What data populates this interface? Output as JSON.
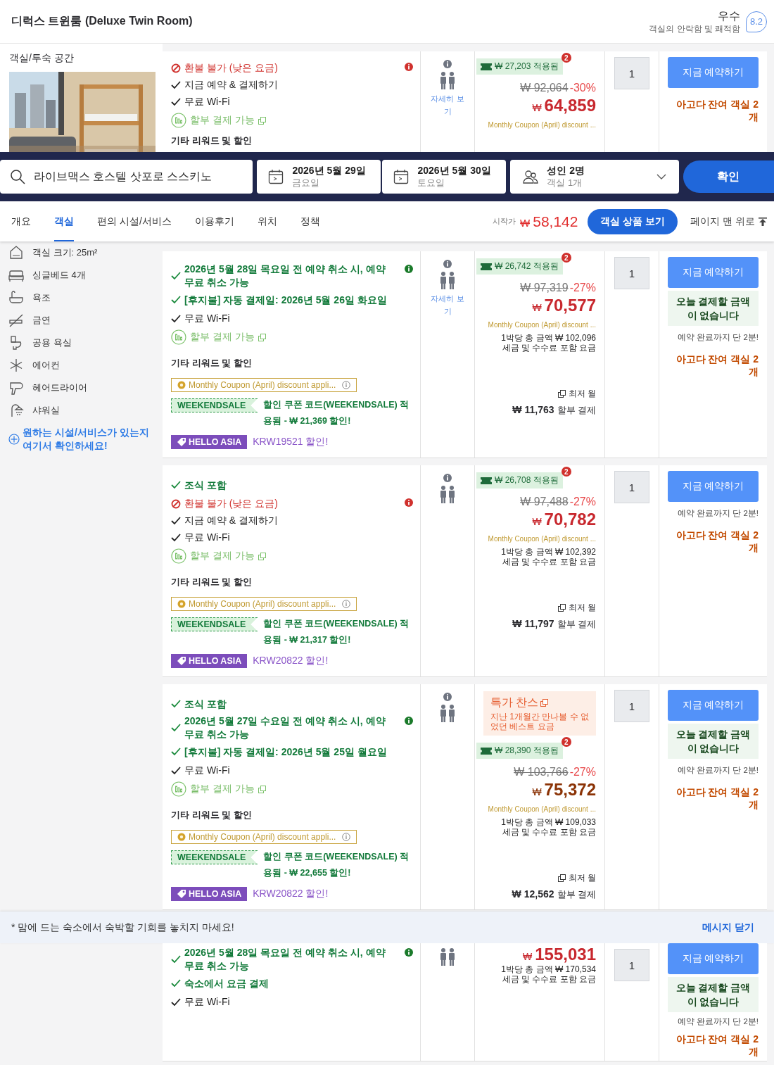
{
  "room": {
    "title": "디럭스 트윈룸 (Deluxe Twin Room)",
    "rating_label": "우수",
    "rating_sub": "객실의 안락함 및 쾌적함",
    "score": "8.2"
  },
  "room_info": {
    "heading": "객실/투숙 공간"
  },
  "top_offer": {
    "features": [
      {
        "kind": "refund",
        "text": "환불 불가 (낮은 요금)",
        "info": true
      },
      {
        "kind": "plain",
        "text": "지금 예약 & 결제하기",
        "info": false
      },
      {
        "kind": "plain",
        "text": "무료 Wi-Fi",
        "info": false
      },
      {
        "kind": "installment",
        "text": "할부 결제 가능",
        "info": false
      }
    ],
    "rewards": {
      "heading": "기타 리워드 및 할인"
    },
    "occupancy": {
      "info": true,
      "details_link": "자세히 보기"
    },
    "price": {
      "applied": "₩ 27,203 적용됨",
      "badge": "2",
      "original": "₩ 92,064",
      "discount": "-30%",
      "currency": "₩",
      "amount": "64,859",
      "coupon_note": "Monthly Coupon (April) discount ..."
    },
    "quantity": "1",
    "book": {
      "button": "지금 예약하기",
      "rooms_left": "아고다 잔여 객실 2개"
    }
  },
  "search": {
    "destination": "라이브맥스 호스텔 삿포로 스스키노",
    "checkin_date": "2026년 5월 29일",
    "checkin_day": "금요일",
    "checkout_date": "2026년 5월 30일",
    "checkout_day": "토요일",
    "guests": "성인 2명",
    "rooms": "객실 1개",
    "confirm": "확인"
  },
  "nav": {
    "tabs": [
      {
        "label": "개요",
        "selected": false
      },
      {
        "label": "객실",
        "selected": true
      },
      {
        "label": "편의 시설/서비스",
        "selected": false
      },
      {
        "label": "이용후기",
        "selected": false
      },
      {
        "label": "위치",
        "selected": false
      },
      {
        "label": "정책",
        "selected": false
      }
    ],
    "from_label": "시작가",
    "from_currency": "₩",
    "from_price": "58,142",
    "view_button": "객실 상품 보기",
    "top_link": "페이지 맨 위로"
  },
  "amenities": [
    {
      "kind": "size",
      "text": "객실 크기: 25m²"
    },
    {
      "kind": "bed",
      "text": "싱글베드 4개"
    },
    {
      "kind": "bath",
      "text": "욕조"
    },
    {
      "kind": "nosmoking",
      "text": "금연"
    },
    {
      "kind": "toilet",
      "text": "공용 욕실"
    },
    {
      "kind": "aircon",
      "text": "에어컨"
    },
    {
      "kind": "hairdryer",
      "text": "헤어드라이어"
    },
    {
      "kind": "shower",
      "text": "샤워실"
    }
  ],
  "amenity_link": "원하는 시설/서비스가 있는지 여기서 확인하세요!",
  "offers": [
    {
      "features": [
        {
          "kind": "included",
          "text": "2026년 5월 28일 목요일 전 예약 취소 시, 예약 무료 취소 가능",
          "info": true
        },
        {
          "kind": "included",
          "text": "[후지불] 자동 결제일: 2026년 5월 26일 화요일",
          "info": false
        },
        {
          "kind": "plain",
          "text": "무료 Wi-Fi",
          "info": false
        },
        {
          "kind": "installment",
          "text": "할부 결제 가능",
          "info": false
        }
      ],
      "rewards": {
        "heading": "기타 리워드 및 할인",
        "coupon": "Monthly Coupon (April) discount appli...",
        "code": "WEEKENDSALE",
        "code_text": "할인 쿠폰 코드(WEEKENDSALE) 적용됨 - ₩ 21,369 할인!",
        "promo": "HELLO ASIA",
        "promo_text": "KRW19521 할인!"
      },
      "occupancy": {
        "info": true,
        "details_link": "자세히 보기"
      },
      "price": {
        "applied": "₩ 26,742 적용됨",
        "badge": "2",
        "original": "₩ 97,319",
        "discount": "-27%",
        "currency": "₩",
        "amount": "70,577",
        "coupon_note": "Monthly Coupon (April) discount ...",
        "total": "1박당 총 금액 ₩ 102,096",
        "tax_note": "세금 및 수수료 포함 요금",
        "monthly_label": "최저 월",
        "monthly": "₩ 11,763",
        "monthly_suffix": "할부 결제"
      },
      "quantity": "1",
      "book": {
        "button": "지금 예약하기",
        "pay_later": "오늘 결제할 금액이 없습니다",
        "timer": "예약 완료까지 단 2분!",
        "rooms_left": "아고다 잔여 객실 2개"
      }
    },
    {
      "features": [
        {
          "kind": "included",
          "text": "조식 포함",
          "info": false
        },
        {
          "kind": "refund",
          "text": "환불 불가 (낮은 요금)",
          "info": true
        },
        {
          "kind": "plain",
          "text": "지금 예약 & 결제하기",
          "info": false
        },
        {
          "kind": "plain",
          "text": "무료 Wi-Fi",
          "info": false
        },
        {
          "kind": "installment",
          "text": "할부 결제 가능",
          "info": false
        }
      ],
      "rewards": {
        "heading": "기타 리워드 및 할인",
        "coupon": "Monthly Coupon (April) discount appli...",
        "code": "WEEKENDSALE",
        "code_text": "할인 쿠폰 코드(WEEKENDSALE) 적용됨 - ₩ 21,317 할인!",
        "promo": "HELLO ASIA",
        "promo_text": "KRW20822 할인!"
      },
      "occupancy": {
        "info": true
      },
      "price": {
        "applied": "₩ 26,708 적용됨",
        "badge": "2",
        "original": "₩ 97,488",
        "discount": "-27%",
        "currency": "₩",
        "amount": "70,782",
        "coupon_note": "Monthly Coupon (April) discount ...",
        "total": "1박당 총 금액 ₩ 102,392",
        "tax_note": "세금 및 수수료 포함 요금",
        "monthly_label": "최저 월",
        "monthly": "₩ 11,797",
        "monthly_suffix": "할부 결제"
      },
      "quantity": "1",
      "book": {
        "button": "지금 예약하기",
        "timer": "예약 완료까지 단 2분!",
        "rooms_left": "아고다 잔여 객실 2개"
      }
    },
    {
      "features": [
        {
          "kind": "included",
          "text": "조식 포함",
          "info": false
        },
        {
          "kind": "included",
          "text": "2026년 5월 27일 수요일 전 예약 취소 시, 예약 무료 취소 가능",
          "info": true
        },
        {
          "kind": "included",
          "text": "[후지불] 자동 결제일: 2026년 5월 25일 월요일",
          "info": false
        },
        {
          "kind": "plain",
          "text": "무료 Wi-Fi",
          "info": false
        },
        {
          "kind": "installment",
          "text": "할부 결제 가능",
          "info": false
        }
      ],
      "rewards": {
        "heading": "기타 리워드 및 할인",
        "coupon": "Monthly Coupon (April) discount appli...",
        "code": "WEEKENDSALE",
        "code_text": "할인 쿠폰 코드(WEEKENDSALE) 적용됨 - ₩ 22,655 할인!",
        "promo": "HELLO ASIA",
        "promo_text": "KRW20822 할인!"
      },
      "occupancy": {
        "info": true
      },
      "price": {
        "deal_title": "특가 찬스",
        "deal_text": "지난 1개월간 만나볼 수 없었던 베스트 요금",
        "applied": "₩ 28,390 적용됨",
        "badge": "2",
        "original": "₩ 103,766",
        "discount": "-27%",
        "currency": "₩",
        "amount": "75,372",
        "coupon_note": "Monthly Coupon (April) discount ...",
        "total": "1박당 총 금액 ₩ 109,033",
        "tax_note": "세금 및 수수료 포함 요금",
        "monthly_label": "최저 월",
        "monthly": "₩ 12,562",
        "monthly_suffix": "할부 결제"
      },
      "quantity": "1",
      "book": {
        "button": "지금 예약하기",
        "pay_later": "오늘 결제할 금액이 없습니다",
        "timer": "예약 완료까지 단 2분!",
        "rooms_left": "아고다 잔여 객실 2개"
      }
    }
  ],
  "banner": {
    "text": "* 맘에 드는 숙소에서 숙박할 기회를 놓치지 마세요!",
    "close": "메시지 닫기"
  },
  "bottom_offer": {
    "features": [
      {
        "kind": "included",
        "text": "2026년 5월 28일 목요일 전 예약 취소 시, 예약 무료 취소 가능",
        "info": true
      },
      {
        "kind": "included",
        "text": "숙소에서 요금 결제",
        "info": false
      },
      {
        "kind": "plain",
        "text": "무료 Wi-Fi",
        "info": false
      }
    ],
    "occupancy": {
      "info": false
    },
    "price": {
      "currency": "₩",
      "amount": "155,031",
      "total": "1박당 총 금액 ₩ 170,534",
      "tax_note": "세금 및 수수료 포함 요금"
    },
    "quantity": "1",
    "book": {
      "button": "지금 예약하기",
      "pay_later": "오늘 결제할 금액이 없습니다",
      "timer": "예약 완료까지 단 2분!",
      "rooms_left": "아고다 잔여 객실 2개"
    }
  }
}
